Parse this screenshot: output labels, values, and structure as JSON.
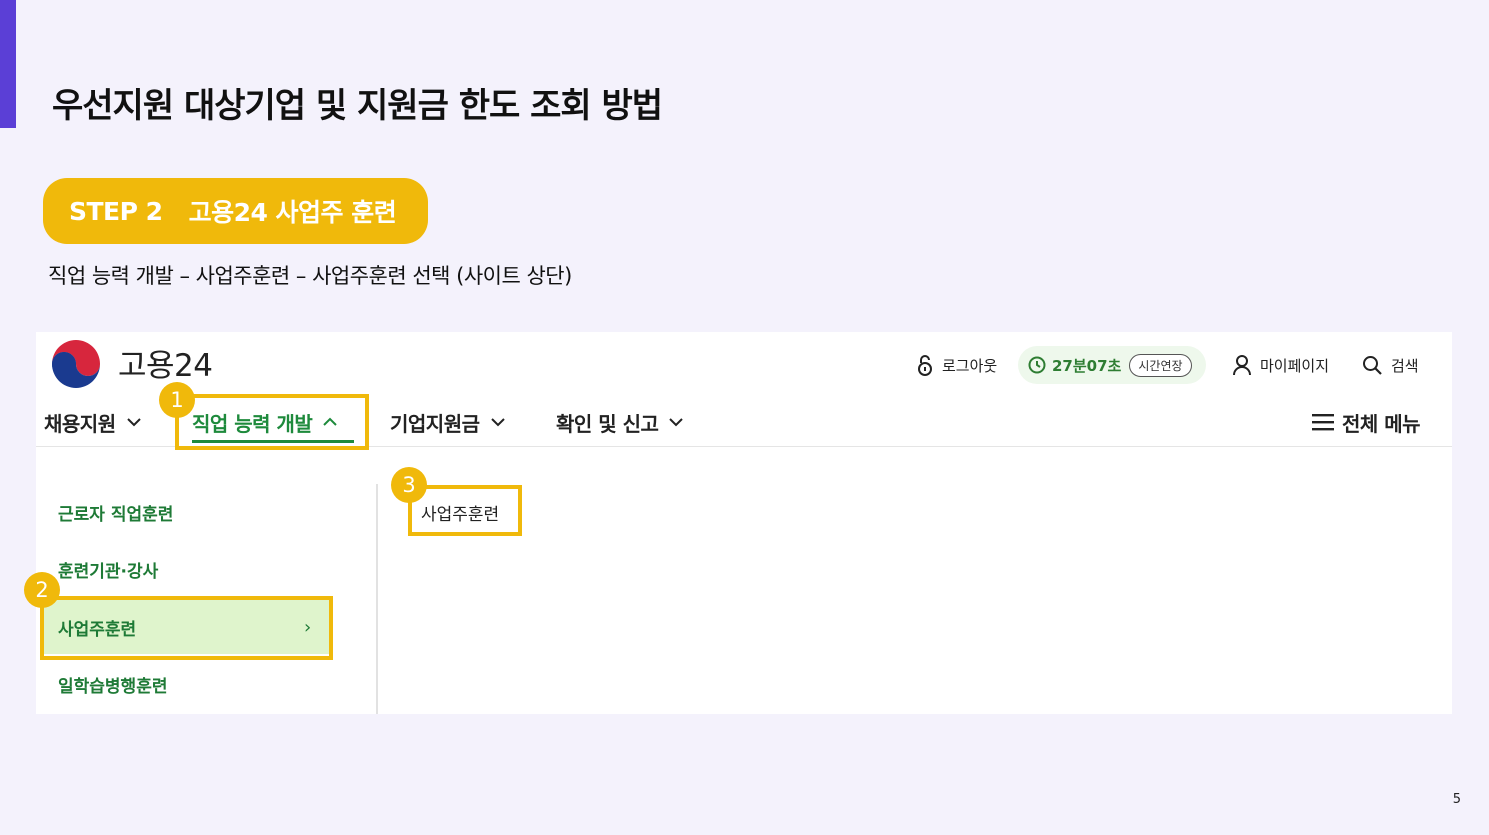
{
  "slide": {
    "title": "우선지원 대상기업 및 지원금 한도 조회 방법",
    "step_label": "STEP 2",
    "step_title": "고용24 사업주 훈련",
    "instruction": "직업 능력 개발 – 사업주훈련 – 사업주훈련 선택 (사이트 상단)",
    "page_number": "5",
    "accent_color": "#5b3fd6",
    "highlight_color": "#f0b90b"
  },
  "site": {
    "brand": "고용24",
    "logo_icon": "taegeuk-logo",
    "utility": {
      "logout": "로그아웃",
      "timer": "27분07초",
      "extend": "시간연장",
      "mypage": "마이페이지",
      "search": "검색"
    },
    "nav": [
      {
        "label": "채용지원"
      },
      {
        "label": "직업 능력 개발",
        "active": true
      },
      {
        "label": "기업지원금"
      },
      {
        "label": "확인 및 신고"
      }
    ],
    "all_menu": "전체 메뉴",
    "sidebar": [
      {
        "label": "근로자 직업훈련"
      },
      {
        "label": "훈련기관·강사"
      },
      {
        "label": "사업주훈련",
        "active": true
      },
      {
        "label": "일학습병행훈련"
      }
    ],
    "submenu": [
      "사업주훈련"
    ],
    "active_color": "#1e8a3c"
  },
  "callouts": [
    "1",
    "2",
    "3"
  ]
}
